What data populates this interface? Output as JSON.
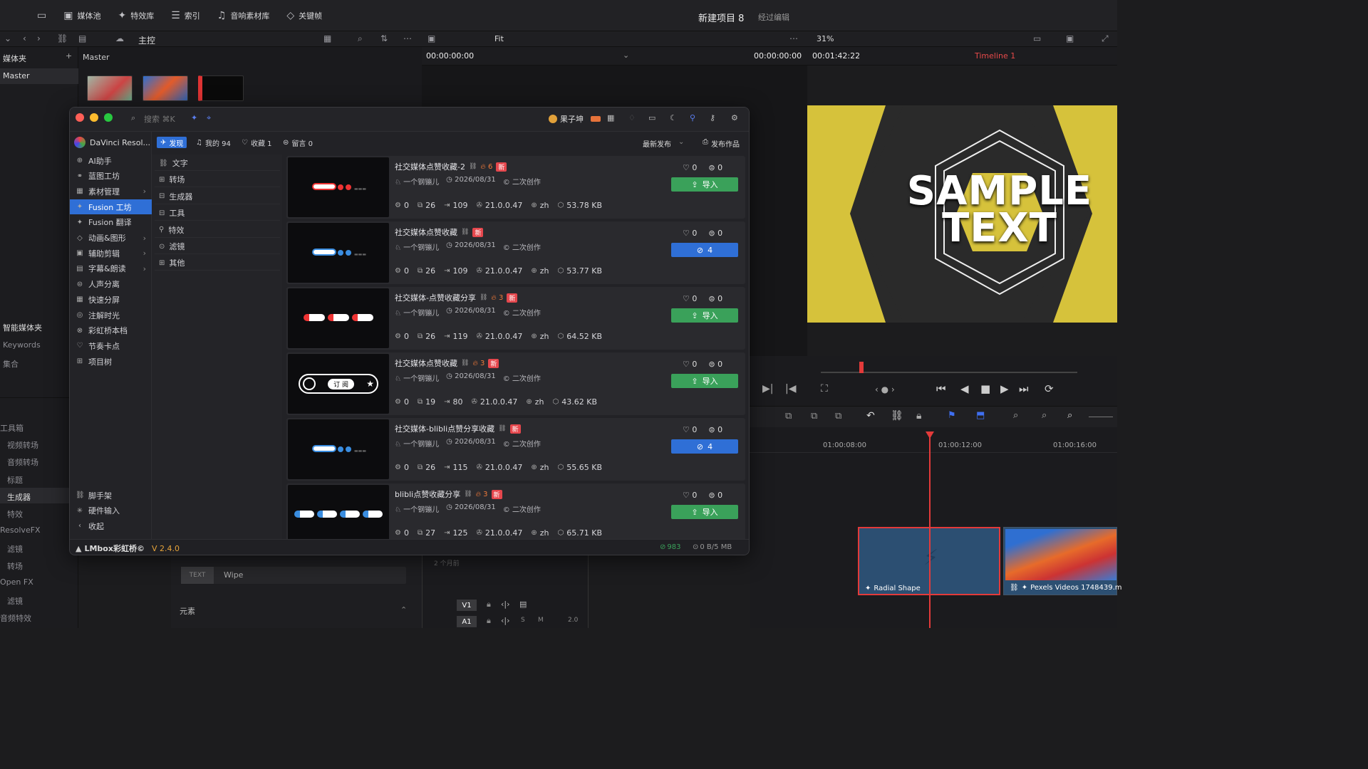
{
  "topbar": {
    "media_pool": "媒体池",
    "effects": "特效库",
    "index": "索引",
    "sound": "音响素材库",
    "keyframes": "关键帧",
    "project": "新建项目 8",
    "edited": "经过编辑"
  },
  "subbar": {
    "master": "主控",
    "fit": "Fit",
    "zoom": "31%"
  },
  "viewer": {
    "master_label": "Master",
    "tc_left": "00:00:00:00",
    "tc_mid": "00:00:00:00",
    "tc_right": "00:01:42:22",
    "timeline_name": "Timeline 1"
  },
  "leftcol": {
    "bin": "媒体夹",
    "master": "Master",
    "smart": "智能媒体夹",
    "keywords": "Keywords",
    "collection": "集合",
    "toolbox": "工具箱",
    "video_trans": "视频转场",
    "audio_trans": "音频转场",
    "titles": "标题",
    "generators": "生成器",
    "effects": "特效",
    "resolvefx": "ResolveFX",
    "filters": "滤镜",
    "transitions": "转场",
    "openfx": "Open FX",
    "filters2": "滤镜",
    "audio_fx": "音频特效"
  },
  "bottom": {
    "wipe": "Wipe",
    "elements": "元素",
    "text": "TEXT",
    "two_months": "2 个月前"
  },
  "preview": {
    "text": "SAMPLE TEXT"
  },
  "timeline": {
    "t1": "01:00:08:00",
    "t2": "01:00:12:00",
    "t3": "01:00:16:00",
    "clip1": "Radial Shape",
    "clip2": "Pexels Videos 1748439.m",
    "v1": "V1",
    "a1": "A1",
    "a1_level": "2.0"
  },
  "plugin": {
    "search_placeholder": "搜索 ⌘K",
    "user": "果子坤",
    "app": "DaVinci Resol...",
    "tabs": {
      "discover": "发现",
      "mine": "我的 94",
      "fav": "收藏 1",
      "comments": "留言 0"
    },
    "sort": "最新发布",
    "publish": "发布作品",
    "sidebar": [
      "AI助手",
      "蓝图工坊",
      "素材管理",
      "Fusion 工坊",
      "Fusion 翻译",
      "动画&图形",
      "辅助剪辑",
      "字幕&朗读",
      "人声分离",
      "快速分屏",
      "注解时光",
      "彩虹桥本档",
      "节奏卡点",
      "项目树"
    ],
    "sidebar_bottom": [
      "脚手架",
      "硬件输入",
      "收起"
    ],
    "categories": [
      "文字",
      "转场",
      "生成器",
      "工具",
      "特效",
      "滤镜",
      "其他"
    ],
    "cards": [
      {
        "title": "社交媒体点赞收藏-2",
        "fire": "6",
        "new": "新",
        "author": "一个钢镚儿",
        "date": "2026/08/31",
        "kind": "二次创作",
        "likes": "0",
        "comments": "0",
        "btn": "导入",
        "s1": "0",
        "s2": "26",
        "s3": "109",
        "ver": "21.0.0.47",
        "lang": "zh",
        "size": "53.78 KB"
      },
      {
        "title": "社交媒体点赞收藏",
        "fire": "",
        "new": "新",
        "author": "一个钢镚儿",
        "date": "2026/08/31",
        "kind": "二次创作",
        "likes": "0",
        "comments": "0",
        "btn": "4",
        "s1": "0",
        "s2": "26",
        "s3": "109",
        "ver": "21.0.0.47",
        "lang": "zh",
        "size": "53.77 KB"
      },
      {
        "title": "社交媒体-点赞收藏分享",
        "fire": "3",
        "new": "新",
        "author": "一个钢镚儿",
        "date": "2026/08/31",
        "kind": "二次创作",
        "likes": "0",
        "comments": "0",
        "btn": "导入",
        "s1": "0",
        "s2": "26",
        "s3": "119",
        "ver": "21.0.0.47",
        "lang": "zh",
        "size": "64.52 KB"
      },
      {
        "title": "社交媒体点赞收藏",
        "fire": "3",
        "new": "新",
        "author": "一个钢镚儿",
        "date": "2026/08/31",
        "kind": "二次创作",
        "likes": "0",
        "comments": "0",
        "btn": "导入",
        "s1": "0",
        "s2": "19",
        "s3": "80",
        "ver": "21.0.0.47",
        "lang": "zh",
        "size": "43.62 KB"
      },
      {
        "title": "社交媒体-blibli点赞分享收藏",
        "fire": "",
        "new": "新",
        "author": "一个钢镚儿",
        "date": "2026/08/31",
        "kind": "二次创作",
        "likes": "0",
        "comments": "0",
        "btn": "4",
        "s1": "0",
        "s2": "26",
        "s3": "115",
        "ver": "21.0.0.47",
        "lang": "zh",
        "size": "55.65 KB"
      },
      {
        "title": "blibli点赞收藏分享",
        "fire": "3",
        "new": "新",
        "author": "一个钢镚儿",
        "date": "2026/08/31",
        "kind": "二次创作",
        "likes": "0",
        "comments": "0",
        "btn": "导入",
        "s1": "0",
        "s2": "27",
        "s3": "125",
        "ver": "21.0.0.47",
        "lang": "zh",
        "size": "65.71 KB"
      }
    ],
    "thumb4_label": "订 阅",
    "footer": {
      "brand": "LMbox彩虹桥©",
      "version": "V 2.4.0",
      "count": "983",
      "traffic": "0 B/5 MB"
    }
  },
  "colors": {
    "accent": "#2f6fd6",
    "green": "#3aa15a",
    "new": "#e5474d",
    "yellow": "#d6c23b",
    "playhead": "#e33a3a"
  }
}
